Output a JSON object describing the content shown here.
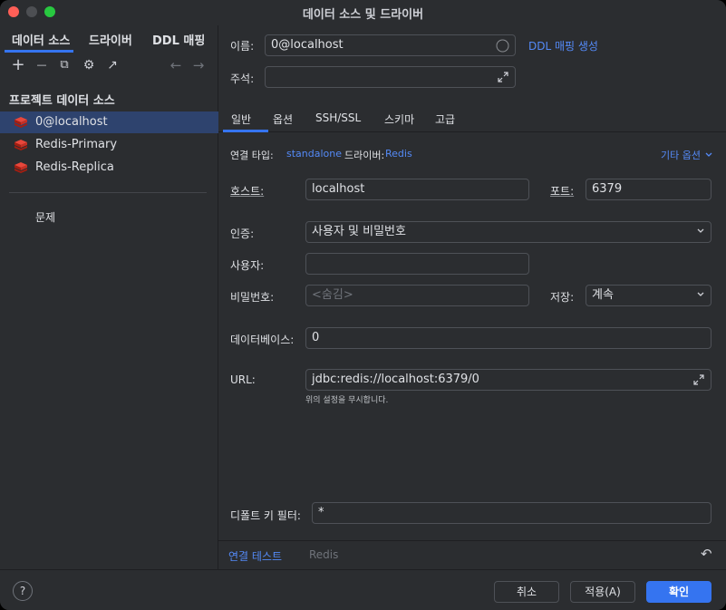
{
  "window": {
    "title": "데이터 소스 및 드라이버",
    "traffic_colors": [
      "#ff5f57",
      "#febc2e",
      "#28c840"
    ]
  },
  "left_tabs": [
    "데이터 소스",
    "드라이버",
    "DDL 매핑"
  ],
  "left_toolbar": {
    "add": "+",
    "remove": "—",
    "copy": "⧉",
    "settings": "⚙",
    "export": "↗",
    "back": "←",
    "forward": "→"
  },
  "section_title": "프로젝트 데이터 소스",
  "data_sources": [
    {
      "label": "0@localhost",
      "icon": "redis-icon",
      "selected": true
    },
    {
      "label": "Redis-Primary",
      "icon": "redis-icon",
      "selected": false
    },
    {
      "label": "Redis-Replica",
      "icon": "redis-icon",
      "selected": false
    }
  ],
  "problems_label": "문제",
  "form": {
    "name_label": "이름:",
    "name_value": "0@localhost",
    "ddl_link": "DDL 매핑 생성",
    "comment_label": "주석:",
    "comment_value": ""
  },
  "right_tabs": [
    "일반",
    "옵션",
    "SSH/SSL",
    "스키마",
    "고급"
  ],
  "connection": {
    "type_label": "연결 타입:",
    "type_value": "standalone",
    "driver_label": "드라이버:",
    "driver_value": "Redis",
    "more_options": "기타 옵션"
  },
  "fields": {
    "host_label": "호스트:",
    "host_value": "localhost",
    "port_label": "포트:",
    "port_value": "6379",
    "auth_label": "인증:",
    "auth_value": "사용자 및 비밀번호",
    "user_label": "사용자:",
    "user_value": "",
    "password_label": "비밀번호:",
    "password_placeholder": "<숨김>",
    "save_label": "저장:",
    "save_value": "계속",
    "database_label": "데이터베이스:",
    "database_value": "0",
    "url_label": "URL:",
    "url_value": "jdbc:redis://localhost:6379/0",
    "url_hint": "위의 설정을 무시합니다.",
    "default_key_filter_label": "디폴트 키 필터:",
    "default_key_filter_value": "*"
  },
  "bottom": {
    "test_connection": "연결 테스트",
    "driver_name": "Redis",
    "reset": "↶"
  },
  "footer": {
    "help": "?",
    "cancel": "취소",
    "apply": "적용(A)",
    "ok": "확인"
  },
  "colors": {
    "accent": "#3574f0",
    "link": "#548af7",
    "selection": "#2e436e",
    "redis": "#d82c20"
  }
}
